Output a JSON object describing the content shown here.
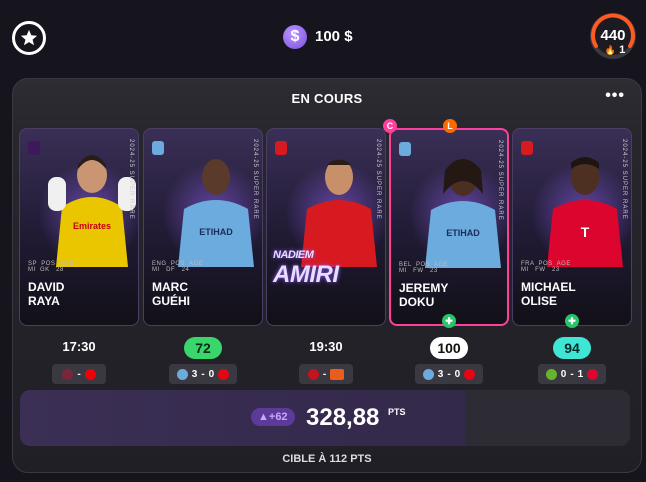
{
  "header": {
    "balance": "100 $",
    "coin_symbol": "$",
    "score": "440",
    "streak": "1"
  },
  "panel": {
    "title": "EN COURS",
    "more_label": "•••",
    "total_delta": "+62",
    "total_points": "328,88",
    "total_unit": "PTS",
    "target": "CIBLE À 112 PTS"
  },
  "cards": [
    {
      "first": "DAVID",
      "last": "RAYA",
      "stats": "SP  POS  AGE\nMI  GK   28",
      "jersey": "#e9c600",
      "edition": "2024-25  SUPER RARE",
      "status": "17:30",
      "status_type": "time",
      "home_score": "",
      "away_score": "",
      "sep": "-",
      "home_color": "#7a263a",
      "away_color": "#ef0107"
    },
    {
      "first": "MARC",
      "last": "GUÉHI",
      "stats": "ENG  POS  AGE\nMI   DF   24",
      "jersey": "#6cabdd",
      "edition": "2024-25  SUPER RARE",
      "status": "72",
      "status_type": "points",
      "badge_color": "#38d66b",
      "badge_text": "#0d2a16",
      "home_score": "3",
      "away_score": "0",
      "sep": "-",
      "home_color": "#6cabdd",
      "away_color": "#e30613"
    },
    {
      "first": "NADIEM",
      "last": "AMIRI",
      "stats": "",
      "jersey": "#d71920",
      "edition": "2024-25  SUPER RARE",
      "status": "19:30",
      "status_type": "time",
      "home_score": "",
      "away_score": "",
      "sep": "-",
      "home_color": "#c3141e",
      "away_color": "#eb5d1b"
    },
    {
      "first": "JEREMY",
      "last": "DOKU",
      "stats": "BEL  POS  AGE\nMI   FW   23",
      "jersey": "#6cabdd",
      "edition": "2024-25  SUPER RARE",
      "status": "100",
      "status_type": "points",
      "badge_color": "#ffffff",
      "badge_text": "#111111",
      "home_score": "3",
      "away_score": "0",
      "sep": "-",
      "home_color": "#6cabdd",
      "away_color": "#e30613"
    },
    {
      "first": "MICHAEL",
      "last": "OLISE",
      "stats": "FRA  POS  AGE\nMI   FW   23",
      "jersey": "#dc052d",
      "edition": "2024-25  SUPER RARE",
      "status": "94",
      "status_type": "points",
      "badge_color": "#40e6d4",
      "badge_text": "#072a27",
      "home_score": "0",
      "away_score": "1",
      "sep": "-",
      "home_color": "#65b32e",
      "away_color": "#dc052d"
    }
  ]
}
